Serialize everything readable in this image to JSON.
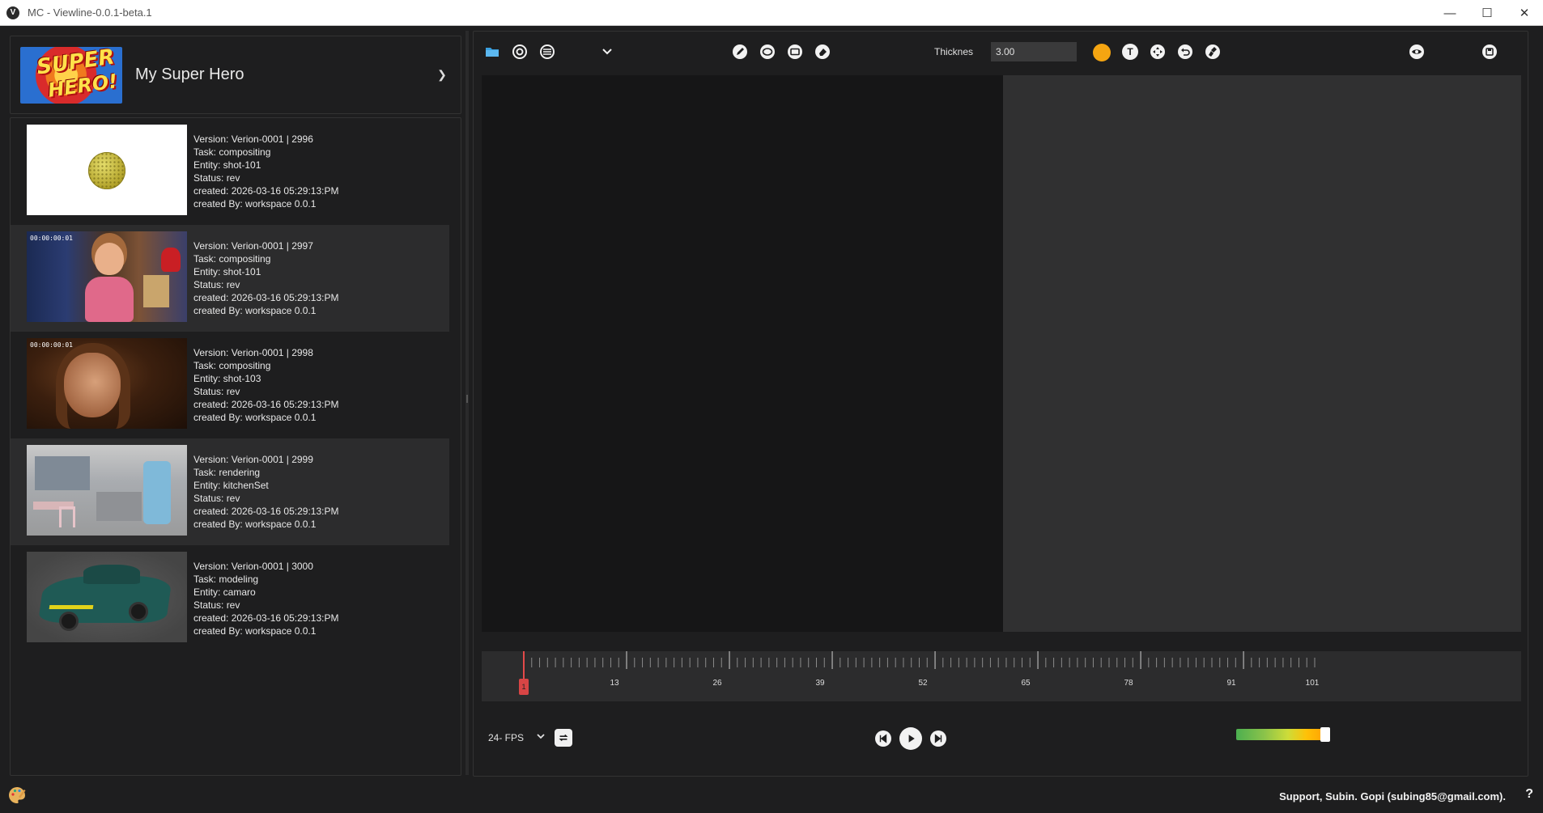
{
  "window": {
    "title": "MC - Viewline-0.0.1-beta.1",
    "app_icon": "V"
  },
  "project": {
    "logo_line1": "SUPER",
    "logo_line2": "HERO!",
    "name": "My Super Hero"
  },
  "versions": [
    {
      "version": "Version: Verion-0001 | 2996",
      "task": "Task: compositing",
      "entity": "Entity: shot-101",
      "status": "Status: rev",
      "created": "created: 2026-03-16 05:29:13:PM",
      "created_by": "created By: workspace 0.0.1"
    },
    {
      "version": "Version: Verion-0001 | 2997",
      "task": "Task: compositing",
      "entity": "Entity: shot-101",
      "status": "Status: rev",
      "created": "created: 2026-03-16 05:29:13:PM",
      "created_by": "created By: workspace 0.0.1",
      "timecode": "00:00:00:01"
    },
    {
      "version": "Version: Verion-0001 | 2998",
      "task": "Task: compositing",
      "entity": "Entity: shot-103",
      "status": "Status: rev",
      "created": "created: 2026-03-16 05:29:13:PM",
      "created_by": "created By: workspace 0.0.1",
      "timecode": "00:00:00:01"
    },
    {
      "version": "Version: Verion-0001 | 2999",
      "task": "Task: rendering",
      "entity": "Entity: kitchenSet",
      "status": "Status: rev",
      "created": "created: 2026-03-16 05:29:13:PM",
      "created_by": "created By: workspace 0.0.1"
    },
    {
      "version": "Version: Verion-0001 | 3000",
      "task": "Task: modeling",
      "entity": "Entity: camaro",
      "status": "Status: rev",
      "created": "created: 2026-03-16 05:29:13:PM",
      "created_by": "created By: workspace 0.0.1"
    }
  ],
  "toolbar": {
    "thickness_label": "Thicknes",
    "thickness_value": "3.00",
    "brush_color": "#f5a511",
    "text_tool": "T"
  },
  "timeline": {
    "current_frame": "1",
    "tick_labels": [
      "13",
      "26",
      "39",
      "52",
      "65",
      "78",
      "91",
      "101"
    ]
  },
  "controls": {
    "fps_label": "24- FPS",
    "volume_level": 0.95
  },
  "status": {
    "support_text": "Support, Subin. Gopi (subing85@gmail.com).",
    "help": "?"
  }
}
